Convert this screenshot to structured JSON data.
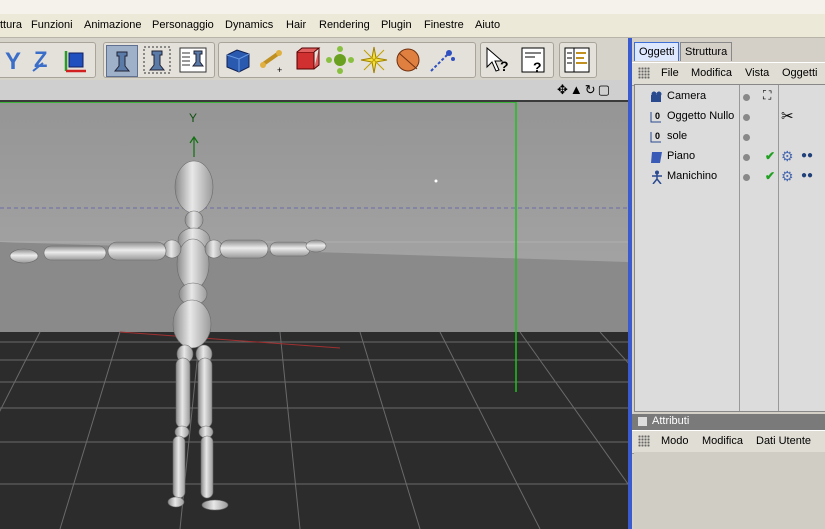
{
  "menu": [
    "ttura",
    "Funzioni",
    "Animazione",
    "Personaggio",
    "Dynamics",
    "Hair",
    "Rendering",
    "Plugin",
    "Finestre",
    "Aiuto"
  ],
  "toolbar": {
    "axis_icons": [
      "y-axis-icon",
      "z-axis-icon",
      "world-coords-icon"
    ],
    "tools": [
      "render-view-icon",
      "render-region-icon",
      "render-settings-icon",
      "cube-icon",
      "bone-tool-icon",
      "deformer-icon",
      "array-icon",
      "light-icon",
      "environment-icon",
      "particles-icon",
      "pointer-help-icon",
      "script-help-icon",
      "timeline-icon"
    ]
  },
  "viewport": {
    "axis_label": "Y",
    "header_icons": [
      "move-view-icon",
      "zoom-view-icon",
      "rotate-view-icon",
      "maximize-view-icon"
    ]
  },
  "panel": {
    "tabs": [
      "Oggetti",
      "Struttura"
    ],
    "menu": [
      "File",
      "Modifica",
      "Vista",
      "Oggetti"
    ],
    "objects": [
      {
        "name": "Camera",
        "icon": "camera-icon",
        "tag": "camera-target-icon"
      },
      {
        "name": "Oggetto Nullo",
        "icon": "null-object-icon",
        "tag": "tools-icon"
      },
      {
        "name": "sole",
        "icon": "null-object-icon",
        "tag": ""
      },
      {
        "name": "Piano",
        "icon": "plane-icon",
        "tag": "material-icon"
      },
      {
        "name": "Manichino",
        "icon": "mannequin-icon",
        "tag": "material-icon"
      }
    ]
  },
  "attributes": {
    "title": "Attributi",
    "menu": [
      "Modo",
      "Modifica",
      "Dati Utente"
    ]
  }
}
